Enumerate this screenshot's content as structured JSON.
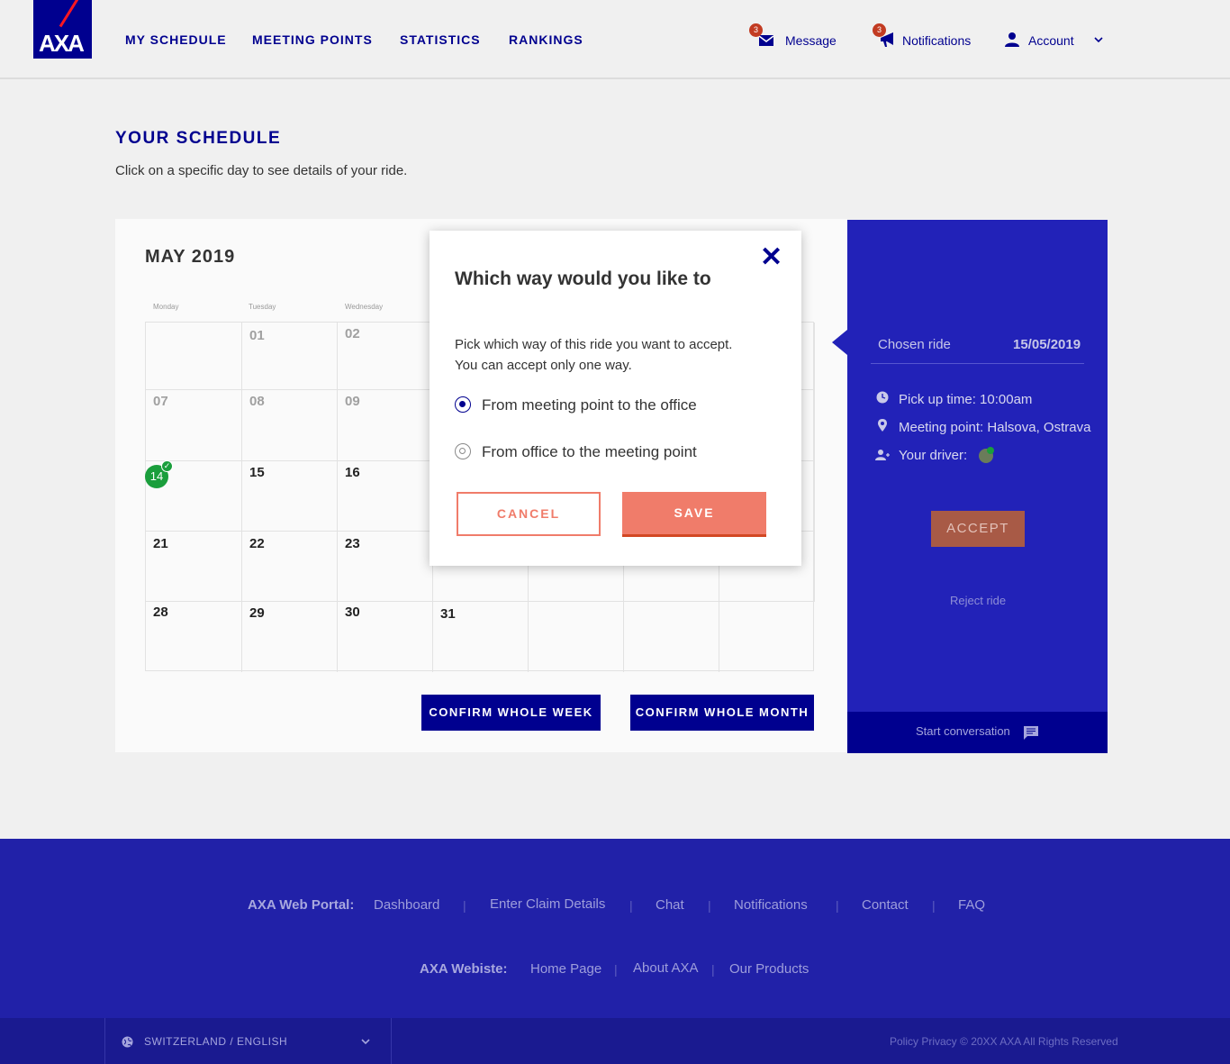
{
  "header": {
    "logo": "AXA",
    "nav": [
      "MY SCHEDULE",
      "MEETING POINTS",
      "STATISTICS",
      "RANKINGS"
    ],
    "message": {
      "label": "Message",
      "badge": "3"
    },
    "notifications": {
      "label": "Notifications",
      "badge": "3"
    },
    "account": {
      "label": "Account"
    }
  },
  "page": {
    "title": "YOUR SCHEDULE",
    "subtitle": "Click on a specific day to see details of your ride."
  },
  "calendar": {
    "month": "MAY 2019",
    "weekdays": [
      "Monday",
      "Tuesday",
      "Wednesday"
    ],
    "days": {
      "d01": "01",
      "d02": "02",
      "d07": "07",
      "d08": "08",
      "d09": "09",
      "d14": "14",
      "d15": "15",
      "d16": "16",
      "d21": "21",
      "d22": "22",
      "d23": "23",
      "d28": "28",
      "d29": "29",
      "d30": "30",
      "d31": "31"
    },
    "confirm_week": "CONFIRM WHOLE WEEK",
    "confirm_month": "CONFIRM WHOLE MONTH"
  },
  "side": {
    "chosen_label": "Chosen ride",
    "date": "15/05/2019",
    "pickup": "Pick up time: 10:00am",
    "meeting_point": "Meeting point: Halsova, Ostrava",
    "driver": "Your driver:",
    "accept": "ACCEPT",
    "reject": "Reject ride",
    "conversation": "Start conversation"
  },
  "modal": {
    "title": "Which way would you like to",
    "desc_line1": "Pick which way of this ride you want to accept.",
    "desc_line2": "You can accept only one way.",
    "option1": "From meeting point to the office",
    "option2": "From office to the meeting point",
    "selected": "option1",
    "cancel": "CANCEL",
    "save": "SAVE"
  },
  "footer": {
    "portal_label": "AXA Web Portal:",
    "portal_links": [
      "Dashboard",
      "Enter Claim Details",
      "Chat",
      "Notifications",
      "Contact",
      "FAQ"
    ],
    "website_label": "AXA Webiste:",
    "website_links": [
      "Home Page",
      "About AXA",
      "Our Products"
    ],
    "language": "SWITZERLAND / ENGLISH",
    "copyright": "Policy Privacy  © 20XX AXA All Rights Reserved"
  },
  "colors": {
    "brand_blue": "#00008f",
    "panel_blue": "#2222b8",
    "accent_coral": "#f07c6a",
    "success_green": "#1a9e3c"
  }
}
